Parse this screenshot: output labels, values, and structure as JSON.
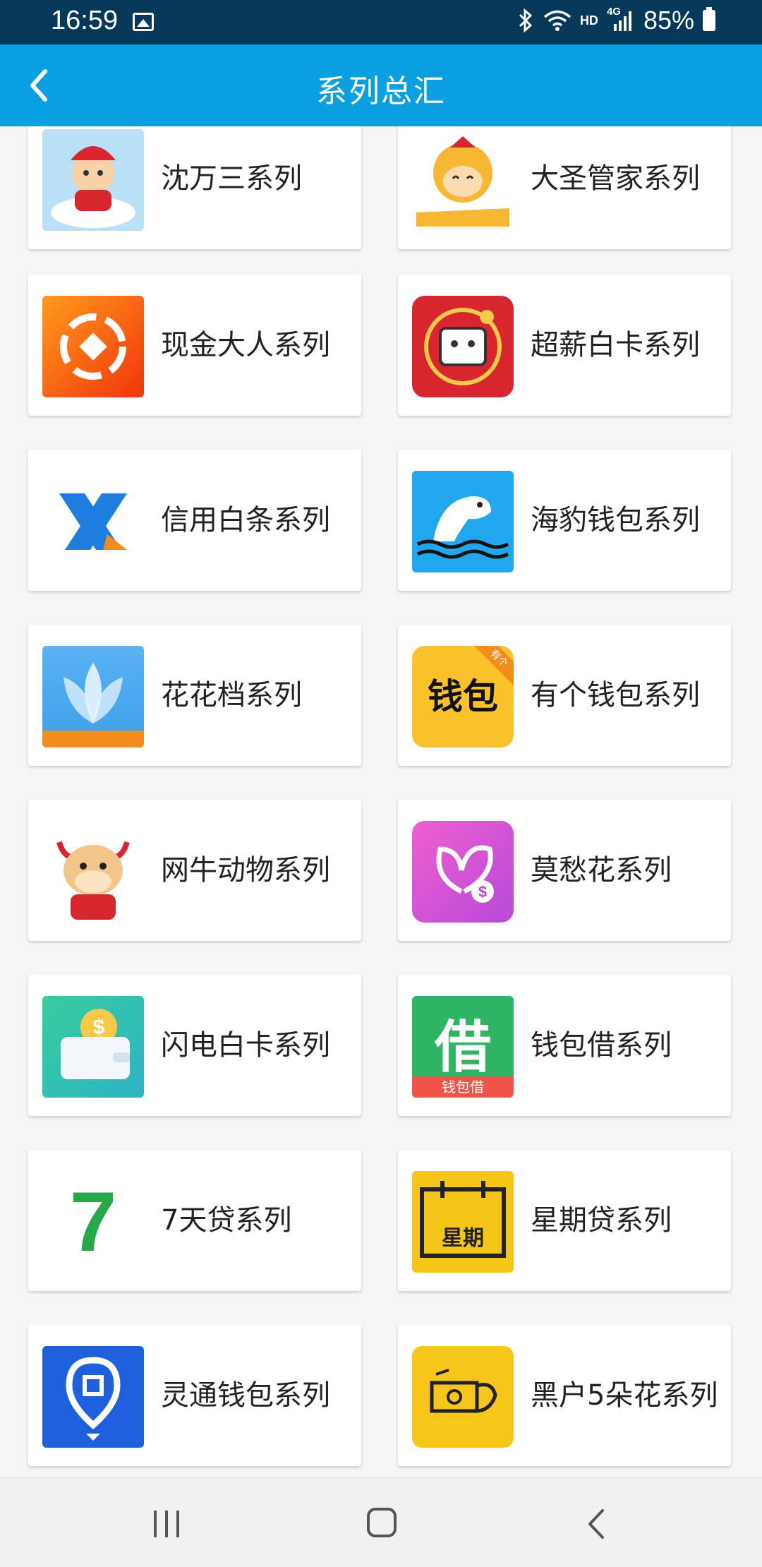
{
  "status_bar": {
    "time": "16:59",
    "network_hd": "HD",
    "network_type": "4G",
    "battery": "85%"
  },
  "header": {
    "title": "系列总汇",
    "back_icon": "chevron-left-icon"
  },
  "series": [
    {
      "label": "沈万三系列",
      "icon": "shen-wansan-icon",
      "color": "#9fd3ef"
    },
    {
      "label": "大圣管家系列",
      "icon": "dasheng-guanjia-icon",
      "color": "#f7b733"
    },
    {
      "label": "现金大人系列",
      "icon": "xianjin-daren-icon",
      "color": "#f35a16"
    },
    {
      "label": "超薪白卡系列",
      "icon": "chaoxin-baika-icon",
      "color": "#d8262e"
    },
    {
      "label": "信用白条系列",
      "icon": "xinyong-baitiao-icon",
      "color": "#1f7de0"
    },
    {
      "label": "海豹钱包系列",
      "icon": "seal-wallet-icon",
      "color": "#22a6ee"
    },
    {
      "label": "花花档系列",
      "icon": "huahuadang-icon",
      "color": "#4fa9ee"
    },
    {
      "label": "有个钱包系列",
      "icon": "youge-wallet-icon",
      "color": "#f9c22a",
      "icon_text": "钱包",
      "corner_text": "有个"
    },
    {
      "label": "网牛动物系列",
      "icon": "cow-icon",
      "color": "#f4c58a"
    },
    {
      "label": "莫愁花系列",
      "icon": "mochou-flower-icon",
      "color": "#d553d0"
    },
    {
      "label": "闪电白卡系列",
      "icon": "wallet-coin-icon",
      "color": "#3fcab0"
    },
    {
      "label": "钱包借系列",
      "icon": "qianbaojie-icon",
      "color": "#2fb365",
      "icon_text": "借",
      "icon_subtext": "钱包借"
    },
    {
      "label": "7天贷系列",
      "icon": "seven-days-icon",
      "color": "#27a84a",
      "icon_text": "7"
    },
    {
      "label": "星期贷系列",
      "icon": "calendar-icon",
      "color": "#f5c518",
      "icon_text": "星期"
    },
    {
      "label": "灵通钱包系列",
      "icon": "location-pin-icon",
      "color": "#1d5fdc"
    },
    {
      "label": "黑户5朵花系列",
      "icon": "money-hand-icon",
      "color": "#f6c61b"
    }
  ],
  "nav_bar": {
    "recents_icon": "recents-icon",
    "home_icon": "home-icon",
    "back_icon": "back-icon"
  }
}
